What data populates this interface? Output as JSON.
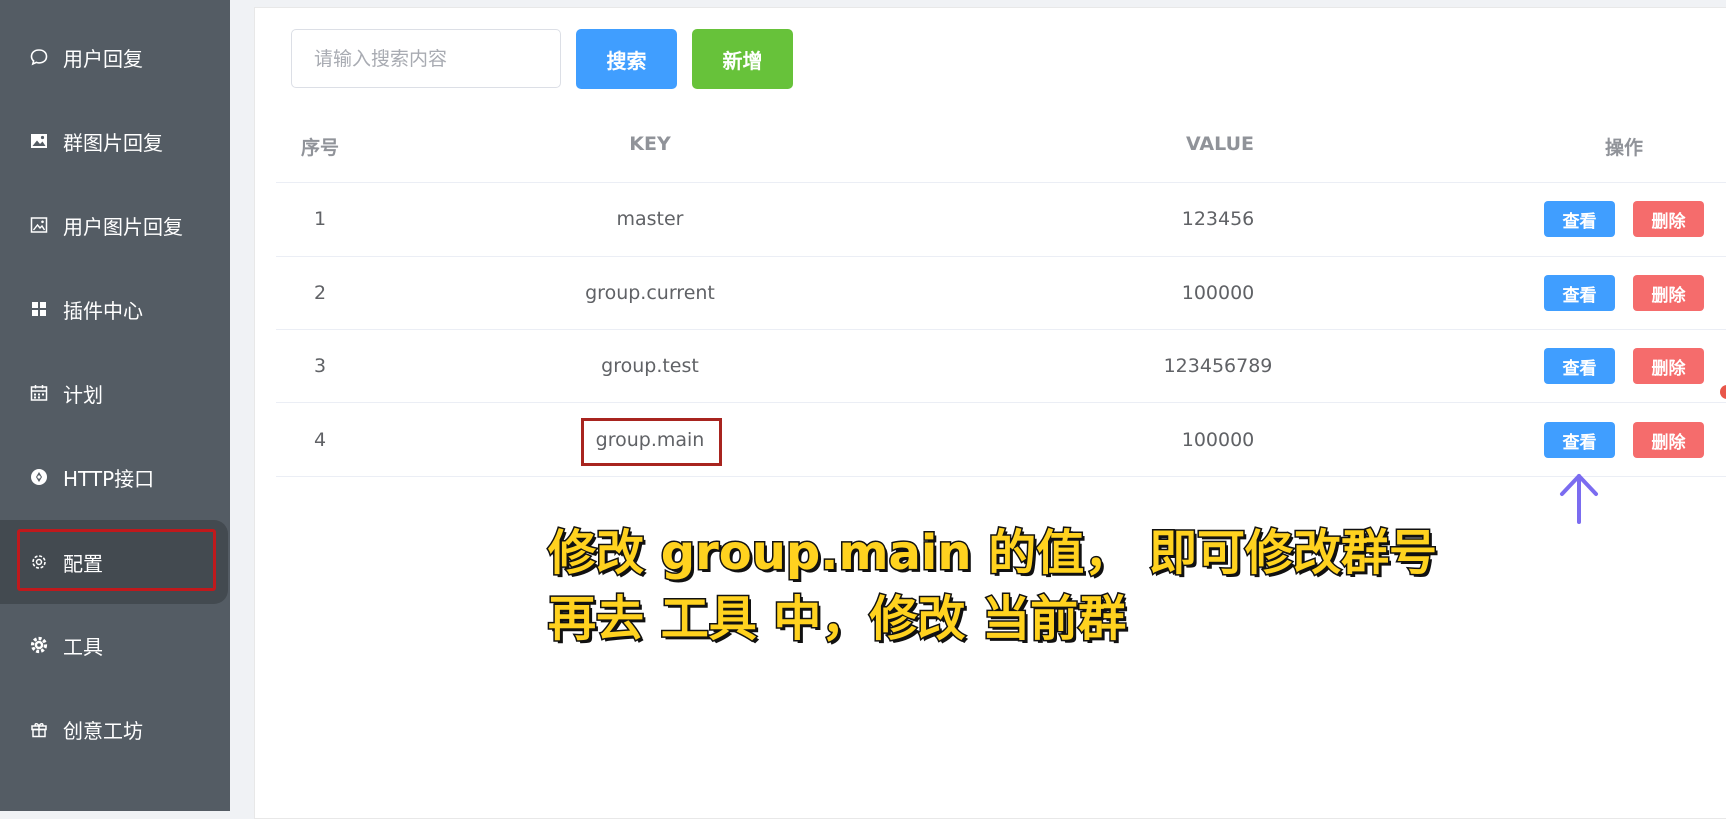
{
  "sidebar": {
    "items": [
      {
        "label": "用户回复",
        "icon": "chat-bubble-icon"
      },
      {
        "label": "群图片回复",
        "icon": "image-icon"
      },
      {
        "label": "用户图片回复",
        "icon": "picture-outline-icon"
      },
      {
        "label": "插件中心",
        "icon": "grid-icon"
      },
      {
        "label": "计划",
        "icon": "calendar-icon"
      },
      {
        "label": "HTTP接口",
        "icon": "api-icon"
      },
      {
        "label": "配置",
        "icon": "gear-outline-icon"
      },
      {
        "label": "工具",
        "icon": "gear-solid-icon"
      },
      {
        "label": "创意工坊",
        "icon": "gift-icon"
      }
    ],
    "active_index": 6
  },
  "toolbar": {
    "search_placeholder": "请输入搜索内容",
    "search_label": "搜索",
    "add_label": "新增"
  },
  "table": {
    "headers": [
      "序号",
      "KEY",
      "VALUE",
      "操作"
    ],
    "rows": [
      {
        "index": "1",
        "key": "master",
        "value": "123456"
      },
      {
        "index": "2",
        "key": "group.current",
        "value": "100000"
      },
      {
        "index": "3",
        "key": "group.test",
        "value": "123456789"
      },
      {
        "index": "4",
        "key": "group.main",
        "value": "100000"
      }
    ],
    "view_label": "查看",
    "delete_label": "删除"
  },
  "caption": {
    "line1": "修改 group.main 的值， 即可修改群号",
    "line2": "再去 工具 中，修改 当前群"
  },
  "colors": {
    "sidebar_bg": "#545c64",
    "primary": "#409eff",
    "success": "#67c23a",
    "danger": "#f56c6c",
    "highlight": "#c0191c",
    "caption": "#ffd21f",
    "arrow": "#7b6cf0"
  }
}
